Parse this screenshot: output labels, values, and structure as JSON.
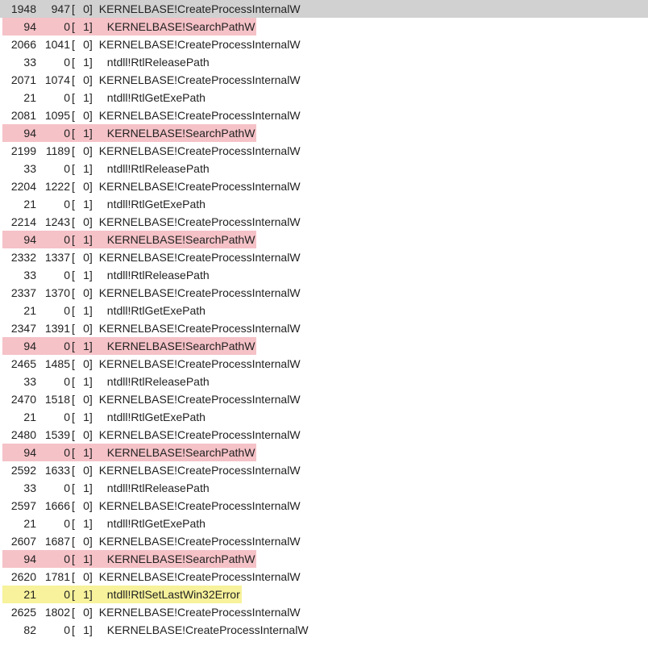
{
  "trace": {
    "rows": [
      {
        "a": "1948",
        "b": "947",
        "c": "0",
        "fn": "KERNELBASE!CreateProcessInternalW",
        "indent": 0,
        "highlight": "selected"
      },
      {
        "a": "94",
        "b": "0",
        "c": "1",
        "fn": "KERNELBASE!SearchPathW",
        "indent": 1,
        "highlight": "pink"
      },
      {
        "a": "2066",
        "b": "1041",
        "c": "0",
        "fn": "KERNELBASE!CreateProcessInternalW",
        "indent": 0,
        "highlight": ""
      },
      {
        "a": "33",
        "b": "0",
        "c": "1",
        "fn": "ntdll!RtlReleasePath",
        "indent": 1,
        "highlight": ""
      },
      {
        "a": "2071",
        "b": "1074",
        "c": "0",
        "fn": "KERNELBASE!CreateProcessInternalW",
        "indent": 0,
        "highlight": ""
      },
      {
        "a": "21",
        "b": "0",
        "c": "1",
        "fn": "ntdll!RtlGetExePath",
        "indent": 1,
        "highlight": ""
      },
      {
        "a": "2081",
        "b": "1095",
        "c": "0",
        "fn": "KERNELBASE!CreateProcessInternalW",
        "indent": 0,
        "highlight": ""
      },
      {
        "a": "94",
        "b": "0",
        "c": "1",
        "fn": "KERNELBASE!SearchPathW",
        "indent": 1,
        "highlight": "pink"
      },
      {
        "a": "2199",
        "b": "1189",
        "c": "0",
        "fn": "KERNELBASE!CreateProcessInternalW",
        "indent": 0,
        "highlight": ""
      },
      {
        "a": "33",
        "b": "0",
        "c": "1",
        "fn": "ntdll!RtlReleasePath",
        "indent": 1,
        "highlight": ""
      },
      {
        "a": "2204",
        "b": "1222",
        "c": "0",
        "fn": "KERNELBASE!CreateProcessInternalW",
        "indent": 0,
        "highlight": ""
      },
      {
        "a": "21",
        "b": "0",
        "c": "1",
        "fn": "ntdll!RtlGetExePath",
        "indent": 1,
        "highlight": ""
      },
      {
        "a": "2214",
        "b": "1243",
        "c": "0",
        "fn": "KERNELBASE!CreateProcessInternalW",
        "indent": 0,
        "highlight": ""
      },
      {
        "a": "94",
        "b": "0",
        "c": "1",
        "fn": "KERNELBASE!SearchPathW",
        "indent": 1,
        "highlight": "pink"
      },
      {
        "a": "2332",
        "b": "1337",
        "c": "0",
        "fn": "KERNELBASE!CreateProcessInternalW",
        "indent": 0,
        "highlight": ""
      },
      {
        "a": "33",
        "b": "0",
        "c": "1",
        "fn": "ntdll!RtlReleasePath",
        "indent": 1,
        "highlight": ""
      },
      {
        "a": "2337",
        "b": "1370",
        "c": "0",
        "fn": "KERNELBASE!CreateProcessInternalW",
        "indent": 0,
        "highlight": ""
      },
      {
        "a": "21",
        "b": "0",
        "c": "1",
        "fn": "ntdll!RtlGetExePath",
        "indent": 1,
        "highlight": ""
      },
      {
        "a": "2347",
        "b": "1391",
        "c": "0",
        "fn": "KERNELBASE!CreateProcessInternalW",
        "indent": 0,
        "highlight": ""
      },
      {
        "a": "94",
        "b": "0",
        "c": "1",
        "fn": "KERNELBASE!SearchPathW",
        "indent": 1,
        "highlight": "pink"
      },
      {
        "a": "2465",
        "b": "1485",
        "c": "0",
        "fn": "KERNELBASE!CreateProcessInternalW",
        "indent": 0,
        "highlight": ""
      },
      {
        "a": "33",
        "b": "0",
        "c": "1",
        "fn": "ntdll!RtlReleasePath",
        "indent": 1,
        "highlight": ""
      },
      {
        "a": "2470",
        "b": "1518",
        "c": "0",
        "fn": "KERNELBASE!CreateProcessInternalW",
        "indent": 0,
        "highlight": ""
      },
      {
        "a": "21",
        "b": "0",
        "c": "1",
        "fn": "ntdll!RtlGetExePath",
        "indent": 1,
        "highlight": ""
      },
      {
        "a": "2480",
        "b": "1539",
        "c": "0",
        "fn": "KERNELBASE!CreateProcessInternalW",
        "indent": 0,
        "highlight": ""
      },
      {
        "a": "94",
        "b": "0",
        "c": "1",
        "fn": "KERNELBASE!SearchPathW",
        "indent": 1,
        "highlight": "pink"
      },
      {
        "a": "2592",
        "b": "1633",
        "c": "0",
        "fn": "KERNELBASE!CreateProcessInternalW",
        "indent": 0,
        "highlight": ""
      },
      {
        "a": "33",
        "b": "0",
        "c": "1",
        "fn": "ntdll!RtlReleasePath",
        "indent": 1,
        "highlight": ""
      },
      {
        "a": "2597",
        "b": "1666",
        "c": "0",
        "fn": "KERNELBASE!CreateProcessInternalW",
        "indent": 0,
        "highlight": ""
      },
      {
        "a": "21",
        "b": "0",
        "c": "1",
        "fn": "ntdll!RtlGetExePath",
        "indent": 1,
        "highlight": ""
      },
      {
        "a": "2607",
        "b": "1687",
        "c": "0",
        "fn": "KERNELBASE!CreateProcessInternalW",
        "indent": 0,
        "highlight": ""
      },
      {
        "a": "94",
        "b": "0",
        "c": "1",
        "fn": "KERNELBASE!SearchPathW",
        "indent": 1,
        "highlight": "pink"
      },
      {
        "a": "2620",
        "b": "1781",
        "c": "0",
        "fn": "KERNELBASE!CreateProcessInternalW",
        "indent": 0,
        "highlight": ""
      },
      {
        "a": "21",
        "b": "0",
        "c": "1",
        "fn": "ntdll!RtlSetLastWin32Error",
        "indent": 1,
        "highlight": "yellow"
      },
      {
        "a": "2625",
        "b": "1802",
        "c": "0",
        "fn": "KERNELBASE!CreateProcessInternalW",
        "indent": 0,
        "highlight": ""
      },
      {
        "a": "82",
        "b": "0",
        "c": "1",
        "fn": "KERNELBASE!CreateProcessInternalW",
        "indent": 1,
        "highlight": ""
      }
    ]
  }
}
